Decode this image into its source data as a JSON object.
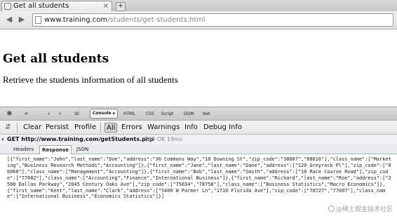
{
  "tab": {
    "title": "Get all students",
    "close": "×",
    "new_tab": "+"
  },
  "nav": {
    "back": "◀",
    "forward": "▶",
    "url_host": "www.training.com",
    "url_path": "/students/get-students.html"
  },
  "page": {
    "heading": "Get all students",
    "description": "Retrieve the students information of all students"
  },
  "firebug": {
    "tabs": {
      "console": "Console",
      "html": "HTML",
      "css": "CSS",
      "script": "Script",
      "dom": "DOM",
      "net": "Net"
    },
    "console_toolbar": {
      "clear": "Clear",
      "persist": "Persist",
      "profile": "Profile",
      "all": "All",
      "errors": "Errors",
      "warnings": "Warnings",
      "info": "Info",
      "debug_info": "Debug Info"
    },
    "request": {
      "method_url": "GET http://www.training.com/getStudents.php",
      "status": "200 OK 19ms"
    },
    "subtabs": {
      "headers": "Headers",
      "response": "Response",
      "json": "JSON"
    },
    "response_text": "[{\"first_name\":\"John\",\"last_name\":\"Doe\",\"address\":\"36 Commons Way\",\"10 Downing St\",\"zip_code\":\"38807\",\"08816\"],\"class_name\":[\"Marketing\",\"Business Research Methods\",\"Accounting\"]},{\"first_name\":\"Jane\",\"last_name\":\"Dane\",\"address\":[\"120 Greyrock Pl\"],\"zip_code\":[\"06060\"],\"class_name\":[\"Management\",\"Accounting\"]},{\"first_name\":\"Bob\",\"last_name\":\"Smith\",\"address\":[\"10 Race Course Road\"],\"zip_code\":[\"77082\"],\"class_name\":[\"Accounting\",\"Finance\",\"International Business\"]},{\"first_name\":\"Richard\",\"last_name\":\"Roe\",\"address\":[\"2500 Dallas Parkway\",\"2845 Century Oaks Ave\"],\"zip_code\":[\"75034\",\"78758\"],\"class_name\":[\"Business Statistics\",\"Macro Economics\"]},{\"first_name\":\"Kent\",\"last_name\":\"Clark\",\"address\":[\"5400 W Parmer Ln\",\"1710 Florida Ave\"],\"zip_code\":[\"78727\",\"77007\"],\"class_name\":[\"International Business\",\"Economics Statistics\"]}]"
  },
  "watermark": "@稀土掘金技术社区"
}
